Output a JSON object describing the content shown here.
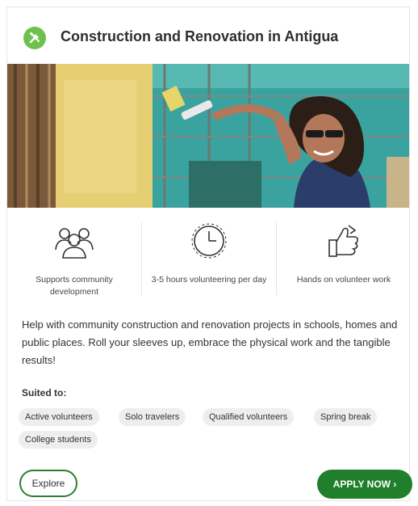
{
  "card": {
    "title": "Construction and Renovation in Antigua",
    "icon": "tools-icon",
    "accent_color": "#6cc24a",
    "features": [
      {
        "icon": "community-people-icon",
        "label": "Supports community development"
      },
      {
        "icon": "clock-icon",
        "label": "3-5 hours volunteering per day"
      },
      {
        "icon": "hand-thumbs-up-icon",
        "label": "Hands on volunteer work"
      }
    ],
    "description": "Help with community construction and renovation projects in schools, homes and public places. Roll your sleeves up, embrace the physical work and the tangible results!",
    "suited_heading": "Suited to:",
    "tags": [
      "Active volunteers",
      "Solo travelers",
      "Qualified volunteers",
      "Spring break",
      "College students"
    ],
    "explore_label": "Explore",
    "apply_label": "APPLY NOW ›",
    "apply_color": "#1f7f2a"
  }
}
